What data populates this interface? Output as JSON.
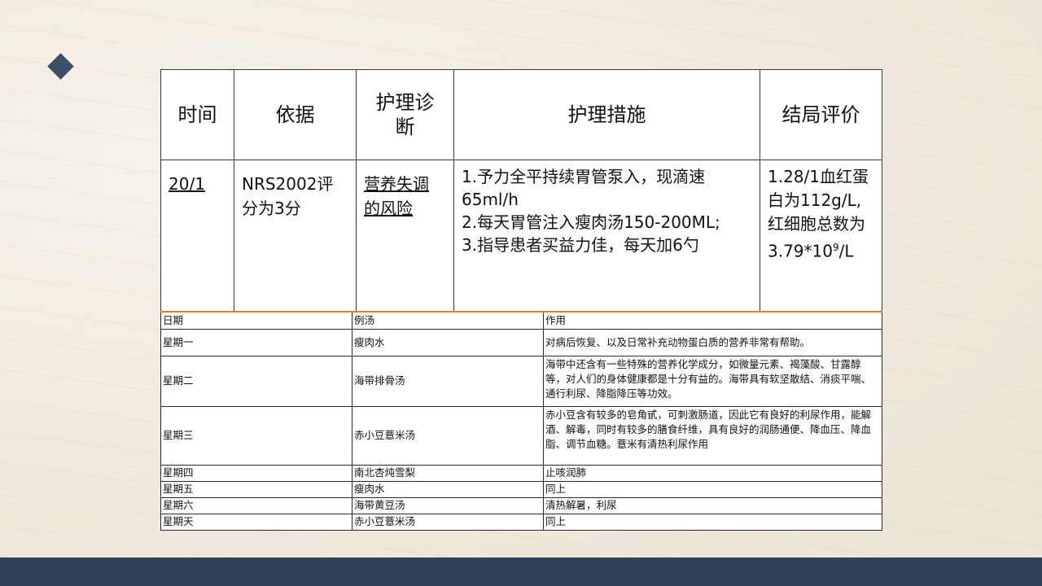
{
  "upper_table": {
    "headers": [
      "时间",
      "依据",
      "护理诊断",
      "护理措施",
      "结局评价"
    ],
    "header_diag_line1": "护理诊",
    "header_diag_line2": "断",
    "row": {
      "time": "20/1",
      "basis_line1": "NRS2002评",
      "basis_line2": "分为3分",
      "diagnosis_line1": "营养失调",
      "diagnosis_line2": "的风险",
      "measures": [
        "1.予力全平持续胃管泵入，现滴速65ml/h",
        "2.每天胃管注入瘦肉汤150-200ML;",
        "3.指导患者买益力佳，每天加6勺"
      ],
      "evaluation_pre": "1.28/1血红蛋白为112g/L,红细胞总数为3.79*10",
      "evaluation_sup": "9",
      "evaluation_post": "/L"
    }
  },
  "lower_table": {
    "headers": [
      "日期",
      "例汤",
      "作用"
    ],
    "rows": [
      {
        "day": "星期一",
        "soup": "瘦肉水",
        "effect": "对病后恢复、以及日常补充动物蛋白质的营养非常有帮助。"
      },
      {
        "day": "星期二",
        "soup": "海带排骨汤",
        "effect": "海带中还含有一些特殊的营养化学成分，如微量元素、褐藻酸、甘露醇等，对人们的身体健康都是十分有益的。海带具有软坚散结、消痰平喘、通行利尿、降脂降压等功效。"
      },
      {
        "day": "星期三",
        "soup": "赤小豆薏米汤",
        "effect": "赤小豆含有较多的皂角甙，可刺激肠道，因此它有良好的利尿作用，能解酒、解毒，同时有较多的膳食纤维，具有良好的润肠通便、降血压、降血脂、调节血糖。薏米有清热利尿作用"
      },
      {
        "day": "星期四",
        "soup": "南北杏炖雪梨",
        "effect": "止咳润肺"
      },
      {
        "day": "星期五",
        "soup": "瘦肉水",
        "effect": "同上"
      },
      {
        "day": "星期六",
        "soup": "海带黄豆汤",
        "effect": "清热解暑，利尿"
      },
      {
        "day": "星期天",
        "soup": "赤小豆薏米汤",
        "effect": "同上"
      }
    ]
  },
  "colors": {
    "footer": "#2f4157",
    "diamond": "#3b5068",
    "accent_line": "#e07c2a"
  },
  "icons": {
    "decor": "diamond-icon"
  }
}
